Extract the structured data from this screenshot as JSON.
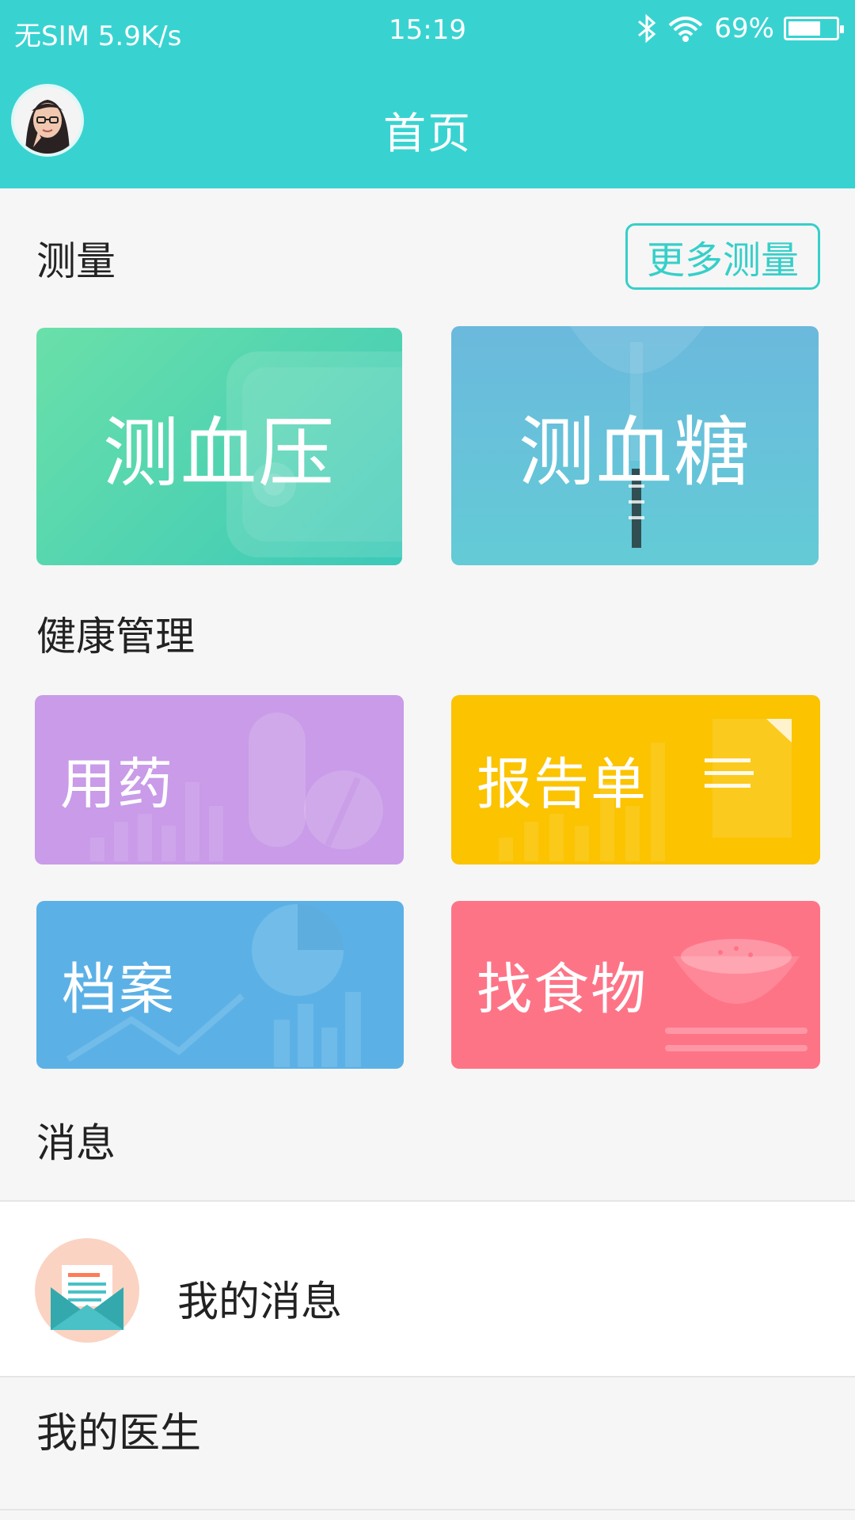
{
  "status_bar": {
    "carrier": "无SIM 5.9K/s",
    "time": "15:19",
    "battery": "69%"
  },
  "header": {
    "title": "首页"
  },
  "measure": {
    "title": "测量",
    "more": "更多测量",
    "items": [
      {
        "label": "测血压",
        "color": "#4dd0b5"
      },
      {
        "label": "测血糖",
        "color": "#64c1d8"
      }
    ]
  },
  "health": {
    "title": "健康管理",
    "items": [
      {
        "label": "用药",
        "color": "#c99be8"
      },
      {
        "label": "报告单",
        "color": "#fbc300"
      },
      {
        "label": "档案",
        "color": "#5bb1e6"
      },
      {
        "label": "找食物",
        "color": "#fe7487"
      }
    ]
  },
  "messages": {
    "title": "消息",
    "my_message": "我的消息",
    "my_doctor": "我的医生"
  },
  "colors": {
    "accent": "#38d3d1"
  },
  "icons": {
    "bluetooth": "bluetooth-icon",
    "wifi": "wifi-icon",
    "battery": "battery-icon",
    "message": "envelope-icon"
  }
}
